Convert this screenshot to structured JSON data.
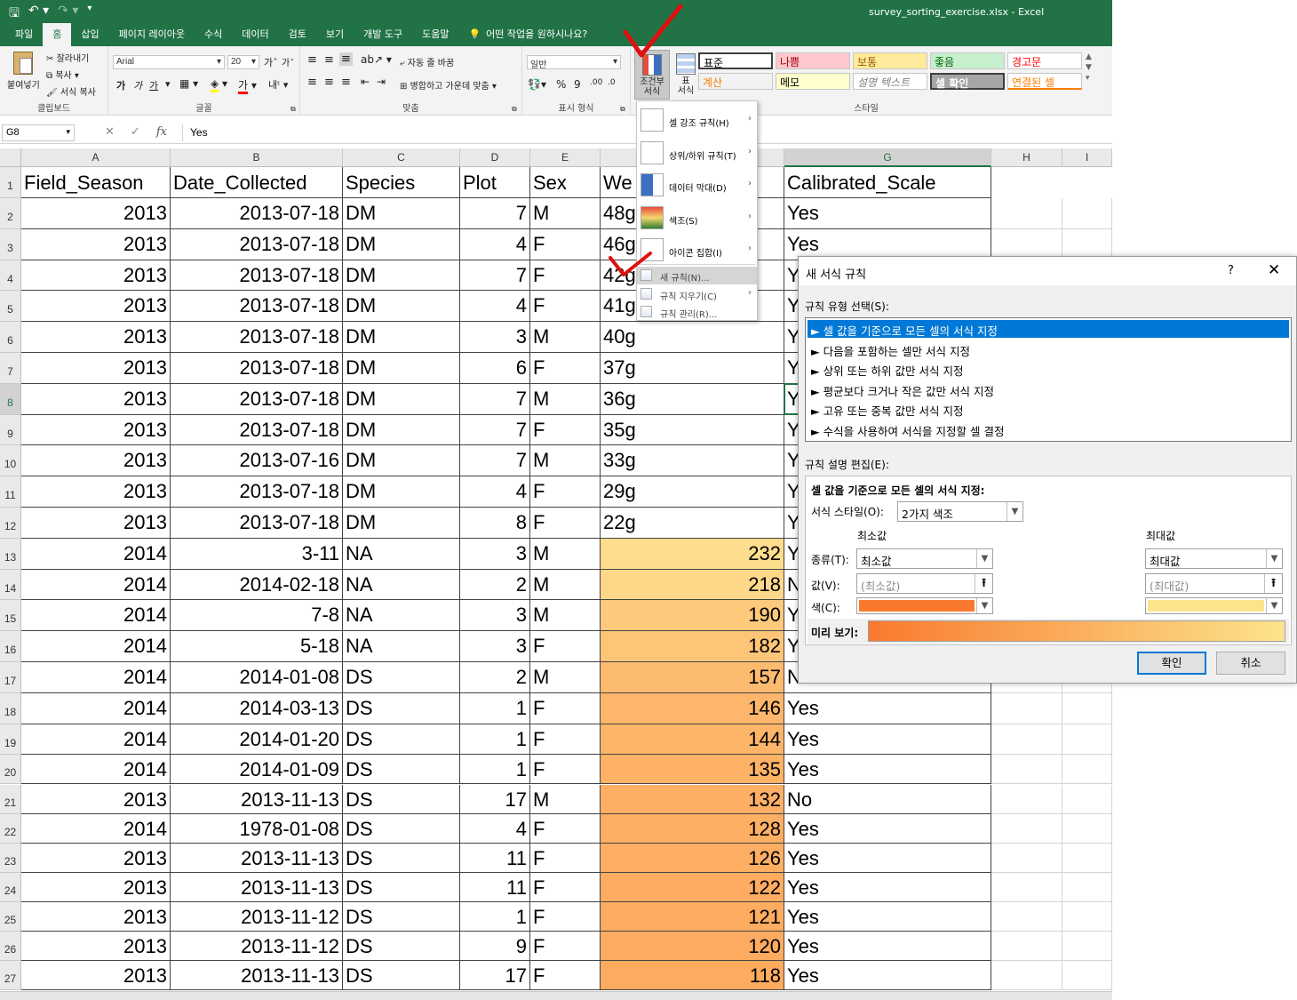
{
  "window": {
    "title": "survey_sorting_exercise.xlsx  -  Excel"
  },
  "ribbon_tabs": [
    "파일",
    "홈",
    "삽입",
    "페이지 레이아웃",
    "수식",
    "데이터",
    "검토",
    "보기",
    "개발 도구",
    "도움말"
  ],
  "tell_me": "어떤 작업을 원하시나요?",
  "clipboard": {
    "paste": "붙여넣기",
    "cut": "잘라내기",
    "copy": "복사",
    "format_painter": "서식 복사",
    "label": "클립보드"
  },
  "font": {
    "name": "Arial",
    "size": "20",
    "label": "글꼴",
    "bold": "가",
    "italic": "가",
    "underline": "가"
  },
  "alignment": {
    "wrap": "자동 줄 바꿈",
    "merge": "병합하고 가운데 맞춤",
    "label": "맞춤"
  },
  "number": {
    "format": "일반",
    "label": "표시 형식"
  },
  "styles": {
    "cond_format": "조건부 서식",
    "table": "표 서식",
    "label": "스타일",
    "cells": [
      {
        "text": "표준",
        "bg": "#ffffff",
        "color": "#000000"
      },
      {
        "text": "나쁨",
        "bg": "#ffc7ce",
        "color": "#9c0006"
      },
      {
        "text": "보통",
        "bg": "#ffeb9c",
        "color": "#9c5700"
      },
      {
        "text": "좋음",
        "bg": "#c6efce",
        "color": "#006100"
      },
      {
        "text": "경고문",
        "bg": "#ffffff",
        "color": "#ff0000"
      },
      {
        "text": "계산",
        "bg": "#f2f2f2",
        "color": "#fa7d00"
      },
      {
        "text": "메모",
        "bg": "#ffffcc",
        "color": "#000000"
      },
      {
        "text": "설명 텍스트",
        "bg": "#ffffff",
        "color": "#7f7f7f"
      },
      {
        "text": "셀 확인",
        "bg": "#a5a5a5",
        "color": "#ffffff"
      },
      {
        "text": "연결된 셀",
        "bg": "#ffffff",
        "color": "#fa7d00"
      }
    ]
  },
  "formula_bar": {
    "name_box": "G8",
    "formula": "Yes"
  },
  "columns": [
    "A",
    "B",
    "C",
    "D",
    "E",
    "F",
    "G",
    "H",
    "I"
  ],
  "sheet": {
    "header": [
      "Field_Season",
      "Date_Collected",
      "Species",
      "Plot",
      "Sex",
      "We",
      "Calibrated_Scale"
    ],
    "rows": [
      {
        "n": "2",
        "a": "2013",
        "b": "2013-07-18",
        "c": "DM",
        "d": "7",
        "e": "M",
        "f": "48g",
        "g": "Yes"
      },
      {
        "n": "3",
        "a": "2013",
        "b": "2013-07-18",
        "c": "DM",
        "d": "4",
        "e": "F",
        "f": "46g",
        "g": "Yes"
      },
      {
        "n": "4",
        "a": "2013",
        "b": "2013-07-18",
        "c": "DM",
        "d": "7",
        "e": "F",
        "f": "42g",
        "g": "Y"
      },
      {
        "n": "5",
        "a": "2013",
        "b": "2013-07-18",
        "c": "DM",
        "d": "4",
        "e": "F",
        "f": "41g",
        "g": "Y"
      },
      {
        "n": "6",
        "a": "2013",
        "b": "2013-07-18",
        "c": "DM",
        "d": "3",
        "e": "M",
        "f": "40g",
        "g": "Y"
      },
      {
        "n": "7",
        "a": "2013",
        "b": "2013-07-18",
        "c": "DM",
        "d": "6",
        "e": "F",
        "f": "37g",
        "g": "Y"
      },
      {
        "n": "8",
        "a": "2013",
        "b": "2013-07-18",
        "c": "DM",
        "d": "7",
        "e": "M",
        "f": "36g",
        "g": "Y"
      },
      {
        "n": "9",
        "a": "2013",
        "b": "2013-07-18",
        "c": "DM",
        "d": "7",
        "e": "F",
        "f": "35g",
        "g": "Y"
      },
      {
        "n": "10",
        "a": "2013",
        "b": "2013-07-16",
        "c": "DM",
        "d": "7",
        "e": "M",
        "f": "33g",
        "g": "Y"
      },
      {
        "n": "11",
        "a": "2013",
        "b": "2013-07-18",
        "c": "DM",
        "d": "4",
        "e": "F",
        "f": "29g",
        "g": "Y"
      },
      {
        "n": "12",
        "a": "2013",
        "b": "2013-07-18",
        "c": "DM",
        "d": "8",
        "e": "F",
        "f": "22g",
        "g": "Y"
      },
      {
        "n": "13",
        "a": "2014",
        "b": "3-11",
        "c": "NA",
        "d": "3",
        "e": "M",
        "f": "232",
        "g": "Y",
        "fill": "#fedd8e"
      },
      {
        "n": "14",
        "a": "2014",
        "b": "2014-02-18",
        "c": "NA",
        "d": "2",
        "e": "M",
        "f": "218",
        "g": "N",
        "fill": "#fed789"
      },
      {
        "n": "15",
        "a": "2014",
        "b": "7-8",
        "c": "NA",
        "d": "3",
        "e": "M",
        "f": "190",
        "g": "Y",
        "fill": "#fdc97c"
      },
      {
        "n": "16",
        "a": "2014",
        "b": "5-18",
        "c": "NA",
        "d": "3",
        "e": "F",
        "f": "182",
        "g": "Y",
        "fill": "#fdc578"
      },
      {
        "n": "17",
        "a": "2014",
        "b": "2014-01-08",
        "c": "DS",
        "d": "2",
        "e": "M",
        "f": "157",
        "g": "No",
        "fill": "#fdbb6f"
      },
      {
        "n": "18",
        "a": "2014",
        "b": "2014-03-13",
        "c": "DS",
        "d": "1",
        "e": "F",
        "f": "146",
        "g": "Yes",
        "fill": "#fdb66b"
      },
      {
        "n": "19",
        "a": "2014",
        "b": "2014-01-20",
        "c": "DS",
        "d": "1",
        "e": "F",
        "f": "144",
        "g": "Yes",
        "fill": "#fdb56a"
      },
      {
        "n": "20",
        "a": "2014",
        "b": "2014-01-09",
        "c": "DS",
        "d": "1",
        "e": "F",
        "f": "135",
        "g": "Yes",
        "fill": "#fdb266"
      },
      {
        "n": "21",
        "a": "2013",
        "b": "2013-11-13",
        "c": "DS",
        "d": "17",
        "e": "M",
        "f": "132",
        "g": "No",
        "fill": "#fdb065"
      },
      {
        "n": "22",
        "a": "2014",
        "b": "1978-01-08",
        "c": "DS",
        "d": "4",
        "e": "F",
        "f": "128",
        "g": "Yes",
        "fill": "#fdaf63"
      },
      {
        "n": "23",
        "a": "2013",
        "b": "2013-11-13",
        "c": "DS",
        "d": "11",
        "e": "F",
        "f": "126",
        "g": "Yes",
        "fill": "#fdae62"
      },
      {
        "n": "24",
        "a": "2013",
        "b": "2013-11-13",
        "c": "DS",
        "d": "11",
        "e": "F",
        "f": "122",
        "g": "Yes",
        "fill": "#fdac61"
      },
      {
        "n": "25",
        "a": "2013",
        "b": "2013-11-12",
        "c": "DS",
        "d": "1",
        "e": "F",
        "f": "121",
        "g": "Yes",
        "fill": "#fdac60"
      },
      {
        "n": "26",
        "a": "2013",
        "b": "2013-11-12",
        "c": "DS",
        "d": "9",
        "e": "F",
        "f": "120",
        "g": "Yes",
        "fill": "#fdab60"
      },
      {
        "n": "27",
        "a": "2013",
        "b": "2013-11-13",
        "c": "DS",
        "d": "17",
        "e": "F",
        "f": "118",
        "g": "Yes",
        "fill": "#fdab5f"
      }
    ]
  },
  "cf_menu": {
    "items": [
      "셀 강조 규칙(H)",
      "상위/하위 규칙(T)",
      "데이터 막대(D)",
      "색조(S)",
      "아이콘 집합(I)"
    ],
    "new_rule": "새 규칙(N)...",
    "clear_rules": "규칙 지우기(C)",
    "manage_rules": "규칙 관리(R)..."
  },
  "dialog": {
    "title": "새 서식 규칙",
    "help": "?",
    "close": "✕",
    "select_type_label": "규칙 유형 선택(S):",
    "rule_types": [
      "► 셀 값을 기준으로 모든 셀의 서식 지정",
      "► 다음을 포함하는 셀만 서식 지정",
      "► 상위 또는 하위 값만 서식 지정",
      "► 평균보다 크거나 작은 값만 서식 지정",
      "► 고유 또는 중복 값만 서식 지정",
      "► 수식을 사용하여 서식을 지정할 셀 결정"
    ],
    "edit_label": "규칙 설명 편집(E):",
    "edit_heading": "셀 값을 기준으로 모든 셀의 서식 지정:",
    "format_style_label": "서식 스타일(O):",
    "format_style": "2가지 색조",
    "min_label": "최소값",
    "max_label": "최대값",
    "type_label": "종류(T):",
    "value_label": "값(V):",
    "color_label": "색(C):",
    "min_type": "최소값",
    "max_type": "최대값",
    "min_value_placeholder": "(최소값)",
    "max_value_placeholder": "(최대값)",
    "min_color": "#f97a2e",
    "max_color": "#fde48c",
    "preview_label": "미리 보기:",
    "ok": "확인",
    "cancel": "취소"
  },
  "colors": {
    "excel_green": "#217346",
    "selection_blue": "#0078d7",
    "annotation_red": "#e01010"
  }
}
